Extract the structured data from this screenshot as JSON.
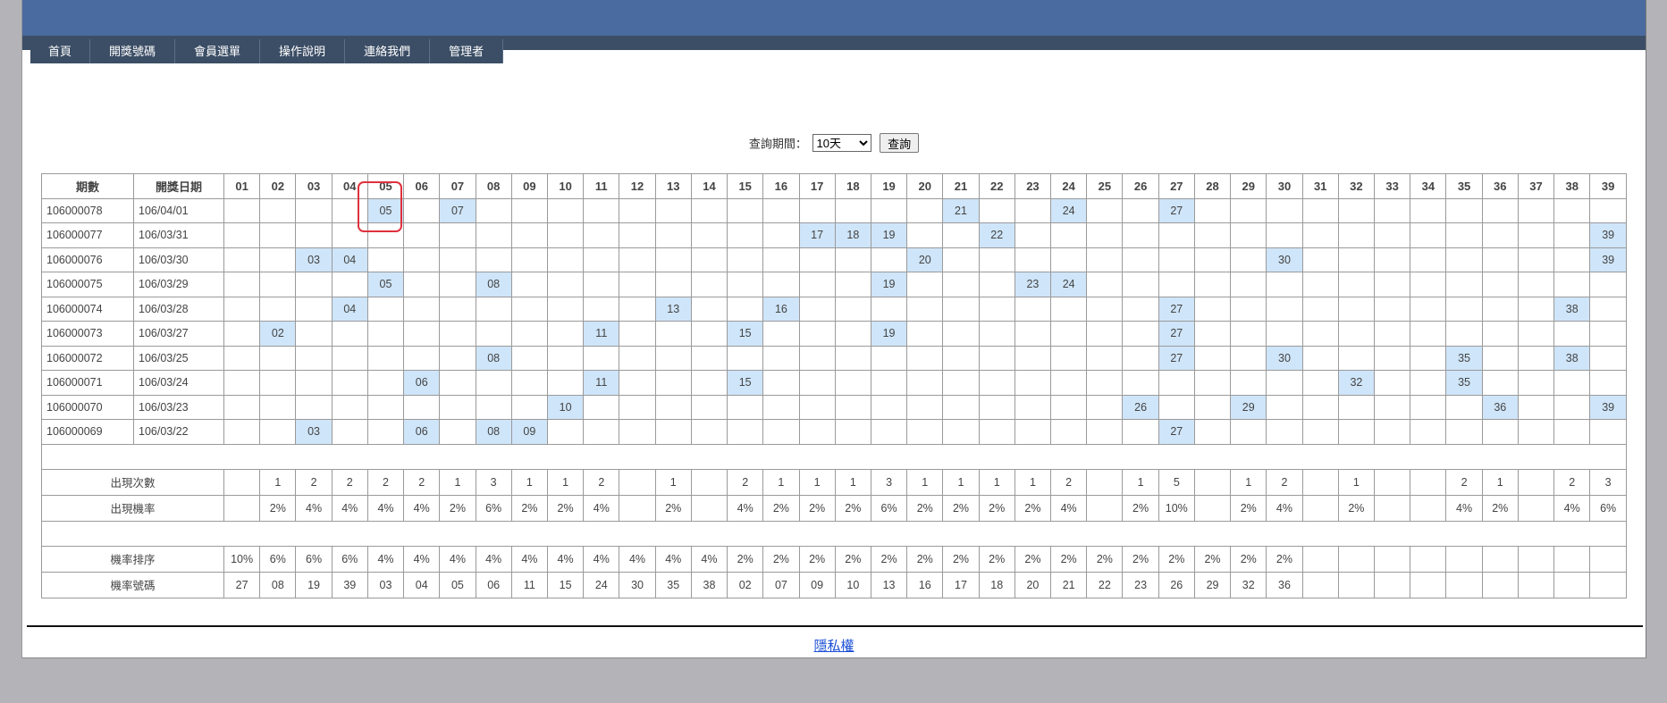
{
  "nav": [
    "首頁",
    "開獎號碼",
    "會員選單",
    "操作說明",
    "連絡我們",
    "管理者"
  ],
  "query": {
    "label": "查詢期間：",
    "selected": "10天",
    "button": "查詢"
  },
  "headers": {
    "period": "期數",
    "date": "開獎日期",
    "numbers": [
      "01",
      "02",
      "03",
      "04",
      "05",
      "06",
      "07",
      "08",
      "09",
      "10",
      "11",
      "12",
      "13",
      "14",
      "15",
      "16",
      "17",
      "18",
      "19",
      "20",
      "21",
      "22",
      "23",
      "24",
      "25",
      "26",
      "27",
      "28",
      "29",
      "30",
      "31",
      "32",
      "33",
      "34",
      "35",
      "36",
      "37",
      "38",
      "39"
    ]
  },
  "draws": [
    {
      "period": "106000078",
      "date": "106/04/01",
      "nums": [
        "05",
        "07",
        "21",
        "24",
        "27"
      ]
    },
    {
      "period": "106000077",
      "date": "106/03/31",
      "nums": [
        "17",
        "18",
        "19",
        "22",
        "39"
      ]
    },
    {
      "period": "106000076",
      "date": "106/03/30",
      "nums": [
        "03",
        "04",
        "20",
        "30",
        "39"
      ]
    },
    {
      "period": "106000075",
      "date": "106/03/29",
      "nums": [
        "05",
        "08",
        "19",
        "23",
        "24"
      ]
    },
    {
      "period": "106000074",
      "date": "106/03/28",
      "nums": [
        "04",
        "13",
        "16",
        "27",
        "38"
      ]
    },
    {
      "period": "106000073",
      "date": "106/03/27",
      "nums": [
        "02",
        "11",
        "15",
        "19",
        "27"
      ]
    },
    {
      "period": "106000072",
      "date": "106/03/25",
      "nums": [
        "08",
        "27",
        "30",
        "35",
        "38"
      ]
    },
    {
      "period": "106000071",
      "date": "106/03/24",
      "nums": [
        "06",
        "11",
        "15",
        "32",
        "35"
      ]
    },
    {
      "period": "106000070",
      "date": "106/03/23",
      "nums": [
        "10",
        "26",
        "29",
        "36",
        "39"
      ]
    },
    {
      "period": "106000069",
      "date": "106/03/22",
      "nums": [
        "03",
        "06",
        "08",
        "09",
        "27"
      ]
    }
  ],
  "stats": {
    "count_label": "出現次數",
    "counts": [
      "",
      "1",
      "2",
      "2",
      "2",
      "2",
      "1",
      "3",
      "1",
      "1",
      "2",
      "",
      "1",
      "",
      "2",
      "1",
      "1",
      "1",
      "3",
      "1",
      "1",
      "1",
      "1",
      "2",
      "",
      "1",
      "5",
      "",
      "1",
      "2",
      "",
      "1",
      "",
      "",
      "2",
      "1",
      "",
      "2",
      "3"
    ],
    "rate_label": "出現機率",
    "rates": [
      "",
      "2%",
      "4%",
      "4%",
      "4%",
      "4%",
      "2%",
      "6%",
      "2%",
      "2%",
      "4%",
      "",
      "2%",
      "",
      "4%",
      "2%",
      "2%",
      "2%",
      "6%",
      "2%",
      "2%",
      "2%",
      "2%",
      "4%",
      "",
      "2%",
      "10%",
      "",
      "2%",
      "4%",
      "",
      "2%",
      "",
      "",
      "4%",
      "2%",
      "",
      "4%",
      "6%"
    ],
    "rank_label": "機率排序",
    "ranks": [
      "10%",
      "6%",
      "6%",
      "6%",
      "4%",
      "4%",
      "4%",
      "4%",
      "4%",
      "4%",
      "4%",
      "4%",
      "4%",
      "4%",
      "2%",
      "2%",
      "2%",
      "2%",
      "2%",
      "2%",
      "2%",
      "2%",
      "2%",
      "2%",
      "2%",
      "2%",
      "2%",
      "2%",
      "2%",
      "2%",
      "",
      "",
      "",
      "",
      "",
      "",
      "",
      "",
      ""
    ],
    "ranknum_label": "機率號碼",
    "ranknums": [
      "27",
      "08",
      "19",
      "39",
      "03",
      "04",
      "05",
      "06",
      "11",
      "15",
      "24",
      "30",
      "35",
      "38",
      "02",
      "07",
      "09",
      "10",
      "13",
      "16",
      "17",
      "18",
      "20",
      "21",
      "22",
      "23",
      "26",
      "29",
      "32",
      "36",
      "",
      "",
      "",
      "",
      "",
      "",
      "",
      "",
      ""
    ]
  },
  "footer": {
    "privacy": "隱私權"
  },
  "colors": {
    "banner": "#4a6b9f",
    "nav": "#3c4e66",
    "hit": "#cfe5f9",
    "highlight": "#e0303c"
  }
}
